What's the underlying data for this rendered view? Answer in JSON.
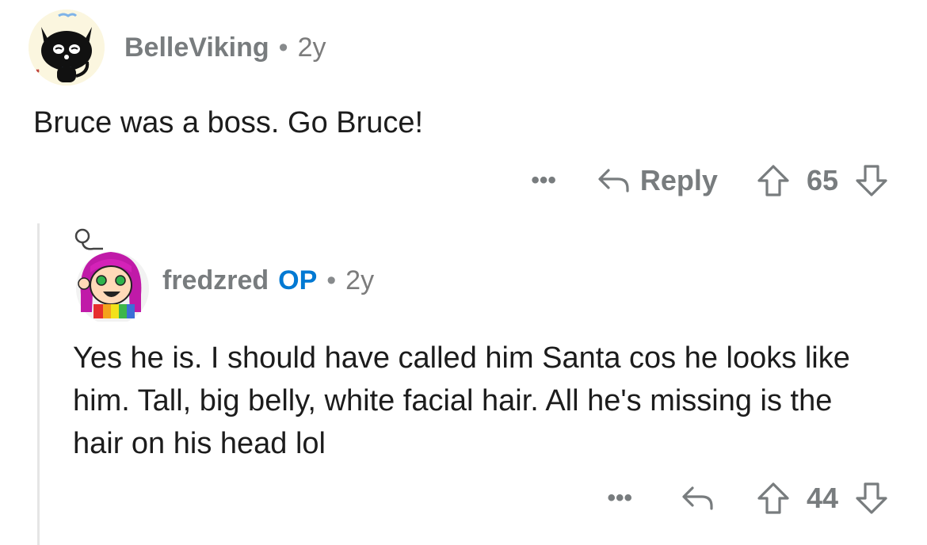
{
  "comments": [
    {
      "username": "BelleViking",
      "separator": "•",
      "age": "2y",
      "body": "Bruce was a boss.  Go Bruce!",
      "actions": {
        "more": "•••",
        "reply_label": "Reply",
        "votes": "65"
      },
      "avatar_icon": "cat-avatar"
    },
    {
      "username": "fredzred",
      "op_badge": "OP",
      "separator": "•",
      "age": "2y",
      "body": "Yes he is. I should have called him Santa cos he looks like him. Tall, big belly, white facial hair. All he's missing is the hair on his head lol",
      "actions": {
        "more": "•••",
        "votes": "44"
      },
      "avatar_icon": "snoo-avatar-pink-hair"
    }
  ],
  "colors": {
    "muted": "#787c7e",
    "op_blue": "#0079d3",
    "thread_line": "#e5e5e5"
  }
}
